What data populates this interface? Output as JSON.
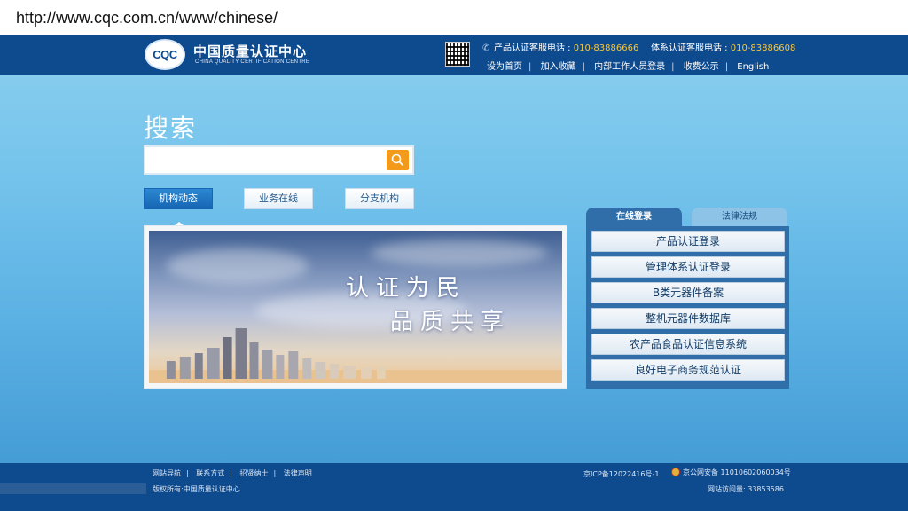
{
  "browser": {
    "url": "http://www.cqc.com.cn/www/chinese/"
  },
  "header": {
    "logo_mark": "CQC",
    "logo_cn": "中国质量认证中心",
    "logo_en": "CHINA QUALITY CERTIFICATION CENTRE",
    "hotline_product_label": "产品认证客服电话 : ",
    "hotline_product_number": "010-83886666",
    "hotline_system_label": "体系认证客服电话 : ",
    "hotline_system_number": "010-83886608",
    "links": [
      "设为首页",
      "加入收藏",
      "内部工作人员登录",
      "收费公示",
      "English"
    ]
  },
  "search": {
    "title": "搜索",
    "placeholder": ""
  },
  "tabs": [
    "机构动态",
    "业务在线",
    "分支机构"
  ],
  "banner": {
    "line1": "认证为民",
    "line2": "品质共享"
  },
  "right_panel": {
    "tabs": [
      "在线登录",
      "法律法规"
    ],
    "items": [
      "产品认证登录",
      "管理体系认证登录",
      "B类元器件备案",
      "整机元器件数据库",
      "农产品食品认证信息系统",
      "良好电子商务规范认证"
    ]
  },
  "footer": {
    "links": [
      "网站导航",
      "联系方式",
      "招贤纳士",
      "法律声明"
    ],
    "copyright": "版权所有:中国质量认证中心",
    "icp": "京ICP备12022416号-1",
    "police": "京公网安备 11010602060034号",
    "visits": "网站访问量: 33853586"
  },
  "colors": {
    "header_bg": "#0e4a8e",
    "accent_orange": "#f39a1b",
    "hotline_number": "#f7c63a"
  }
}
